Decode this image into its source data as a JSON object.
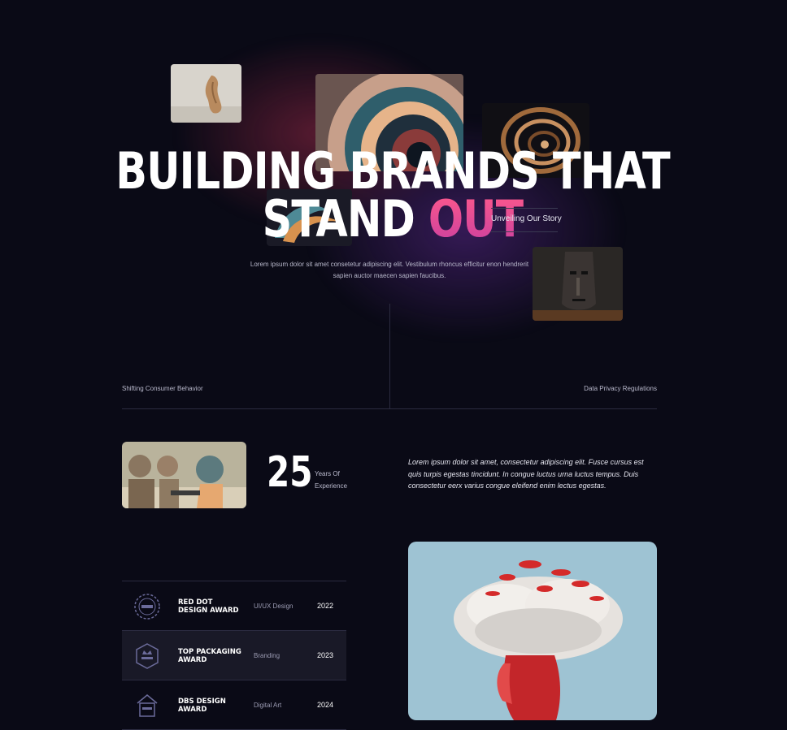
{
  "hero": {
    "title_line1": "BUILDING BRANDS THAT",
    "title_line2_plain": "STAND ",
    "title_line2_accent": "OUT",
    "story_link": "Unveiling Our Story",
    "description": "Lorem ipsum dolor sit amet consetetur adipiscing elit. Vestibulum rhoncus efficitur enon hendrerit sapien auctor maecen sapien faucibus.",
    "accent_color": "#e44f8e"
  },
  "topics": {
    "left": "Shifting Consumer Behavior",
    "right": "Data Privacy Regulations"
  },
  "experience": {
    "number": "25",
    "label": "Years Of Experience",
    "quote": "Lorem ipsum dolor sit amet, consectetur adipiscing elit. Fusce cursus est quis turpis egestas tincidunt. In congue luctus urna luctus tempus. Duis consectetur eerx varius congue eleifend enim lectus egestas."
  },
  "awards": [
    {
      "name": "Red Dot Design Award",
      "category": "UI/UX Design",
      "year": "2022",
      "badge_icon": "laurel-award-icon"
    },
    {
      "name": "Top Packaging Award",
      "category": "Branding",
      "year": "2023",
      "badge_icon": "crown-badge-icon"
    },
    {
      "name": "DBS Design Award",
      "category": "Digital Art",
      "year": "2024",
      "badge_icon": "house-badge-icon"
    }
  ]
}
